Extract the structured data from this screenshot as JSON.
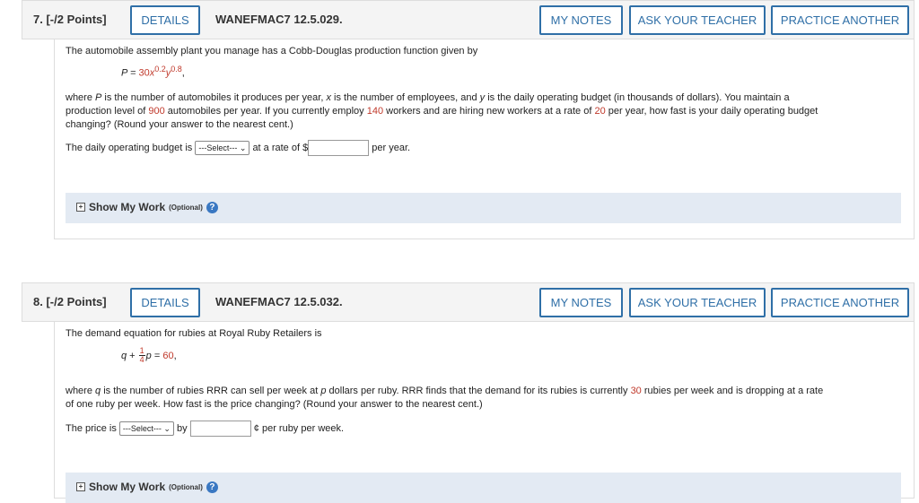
{
  "q7": {
    "points": "7. [-/2 Points]",
    "details": "DETAILS",
    "code": "WANEFMAC7 12.5.029.",
    "my_notes": "MY NOTES",
    "ask_teacher": "ASK YOUR TEACHER",
    "practice": "PRACTICE ANOTHER",
    "intro": "The automobile assembly plant you manage has a Cobb-Douglas production function given by",
    "eq_lhs": "P = ",
    "eq_coef": "30",
    "eq_x": "x",
    "eq_xexp": "0.2",
    "eq_y": "y",
    "eq_yexp": "0.8",
    "eq_end": ",",
    "p1_a": "where ",
    "p1_P": "P",
    "p1_b": " is the number of automobiles it produces per year, ",
    "p1_x": "x",
    "p1_c": " is the number of employees, and ",
    "p1_y": "y",
    "p1_d": " is the daily operating budget (in thousands of dollars). You maintain a",
    "p2_a": "production level of ",
    "p2_900": "900",
    "p2_b": " automobiles per year. If you currently employ ",
    "p2_140": "140",
    "p2_c": " workers and are hiring new workers at a rate of ",
    "p2_20": "20",
    "p2_d": " per year, how fast is your daily operating budget",
    "p3": "changing? (Round your answer to the nearest cent.)",
    "ans_a": "The daily operating budget is",
    "select": "---Select---",
    "ans_b": "at a rate of $",
    "ans_c": "per year.",
    "show_work": "Show My Work",
    "optional": "(Optional)"
  },
  "q8": {
    "points": "8. [-/2 Points]",
    "details": "DETAILS",
    "code": "WANEFMAC7 12.5.032.",
    "my_notes": "MY NOTES",
    "ask_teacher": "ASK YOUR TEACHER",
    "practice": "PRACTICE ANOTHER",
    "intro": "The demand equation for rubies at Royal Ruby Retailers is",
    "eq_q": "q",
    "eq_plus": " + ",
    "eq_num": "1",
    "eq_den": "4",
    "eq_p": "p",
    "eq_eq": " = ",
    "eq_60": "60",
    "eq_end": ",",
    "p1_a": "where ",
    "p1_q": "q",
    "p1_b": " is the number of rubies RRR can sell per week at ",
    "p1_p": "p",
    "p1_c": " dollars per ruby. RRR finds that the demand for its rubies is currently ",
    "p1_30": "30",
    "p1_d": " rubies per week and is dropping at a rate",
    "p2": "of one ruby per week. How fast is the price changing? (Round your answer to the nearest cent.)",
    "ans_a": "The price is",
    "select": "---Select---",
    "ans_b": "by",
    "ans_c": "¢ per ruby per week.",
    "show_work": "Show My Work",
    "optional": "(Optional)"
  }
}
